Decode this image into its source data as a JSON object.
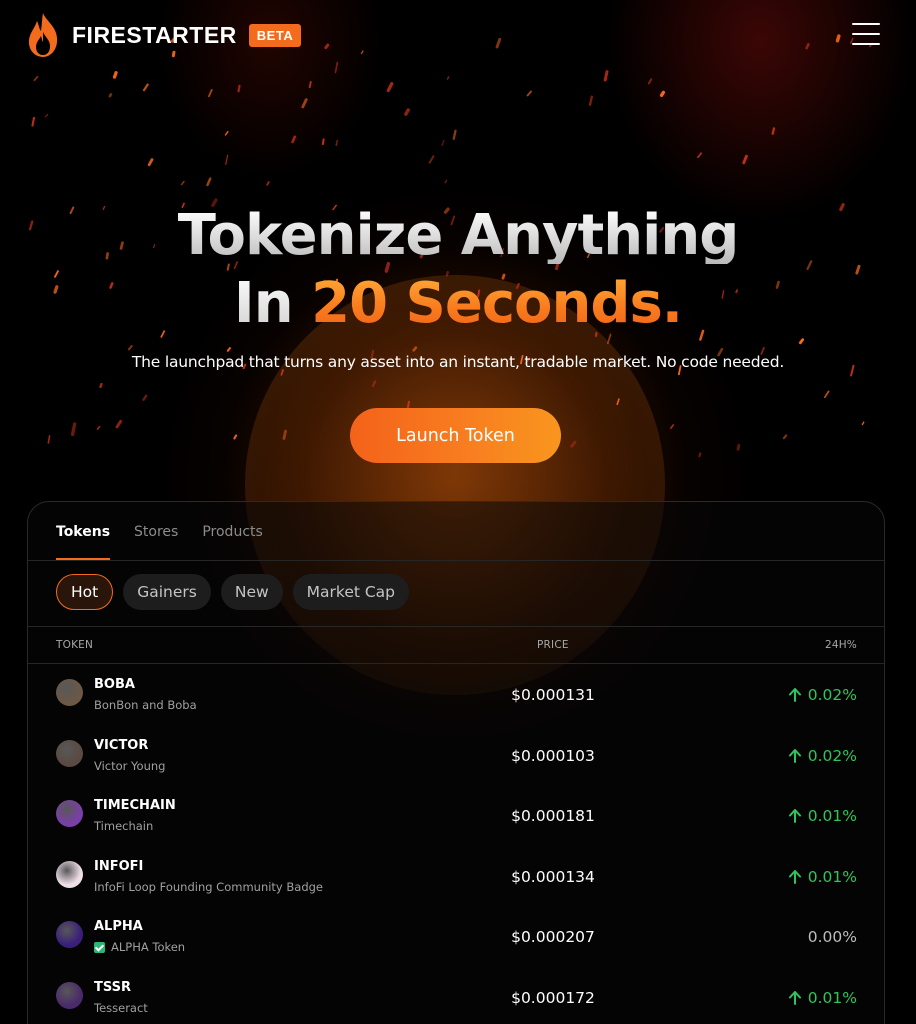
{
  "header": {
    "brand": "FIRESTARTER",
    "badge": "BETA"
  },
  "hero": {
    "title_line1": "Tokenize Anything",
    "title_line2_prefix": "In ",
    "title_line2_accent": "20 Seconds.",
    "subtitle": "The launchpad that turns any asset into an instant, tradable market. No code needed.",
    "cta_label": "Launch Token"
  },
  "tabs": [
    "Tokens",
    "Stores",
    "Products"
  ],
  "active_tab": "Tokens",
  "filters": [
    "Hot",
    "Gainers",
    "New",
    "Market Cap"
  ],
  "active_filter": "Hot",
  "table": {
    "columns": [
      "TOKEN",
      "PRICE",
      "24H%"
    ],
    "rows": [
      {
        "symbol": "BOBA",
        "name": "BonBon and Boba",
        "price": "$0.000131",
        "change": "0.02%",
        "direction": "up",
        "verified": false,
        "avatar_color": "#6b5846"
      },
      {
        "symbol": "VICTOR",
        "name": "Victor Young",
        "price": "$0.000103",
        "change": "0.02%",
        "direction": "up",
        "verified": false,
        "avatar_color": "#5a4a42"
      },
      {
        "symbol": "TIMECHAIN",
        "name": "Timechain",
        "price": "$0.000181",
        "change": "0.01%",
        "direction": "up",
        "verified": false,
        "avatar_color": "#7a3fa8"
      },
      {
        "symbol": "INFOFI",
        "name": "InfoFi Loop Founding Community Badge",
        "price": "$0.000134",
        "change": "0.01%",
        "direction": "up",
        "verified": false,
        "avatar_color": "#f0dfe8"
      },
      {
        "symbol": "ALPHA",
        "name": "ALPHA Token",
        "price": "$0.000207",
        "change": "0.00%",
        "direction": "flat",
        "verified": true,
        "avatar_color": "#3a1f7a"
      },
      {
        "symbol": "TSSR",
        "name": "Tesseract",
        "price": "$0.000172",
        "change": "0.01%",
        "direction": "up",
        "verified": false,
        "avatar_color": "#4a2a6a"
      }
    ]
  },
  "colors": {
    "accent": "#f36b1c",
    "positive": "#2fc55b",
    "background": "#000000"
  },
  "icons": {
    "logo": "flame-icon",
    "menu": "hamburger-menu-icon",
    "up": "arrow-up-icon"
  }
}
